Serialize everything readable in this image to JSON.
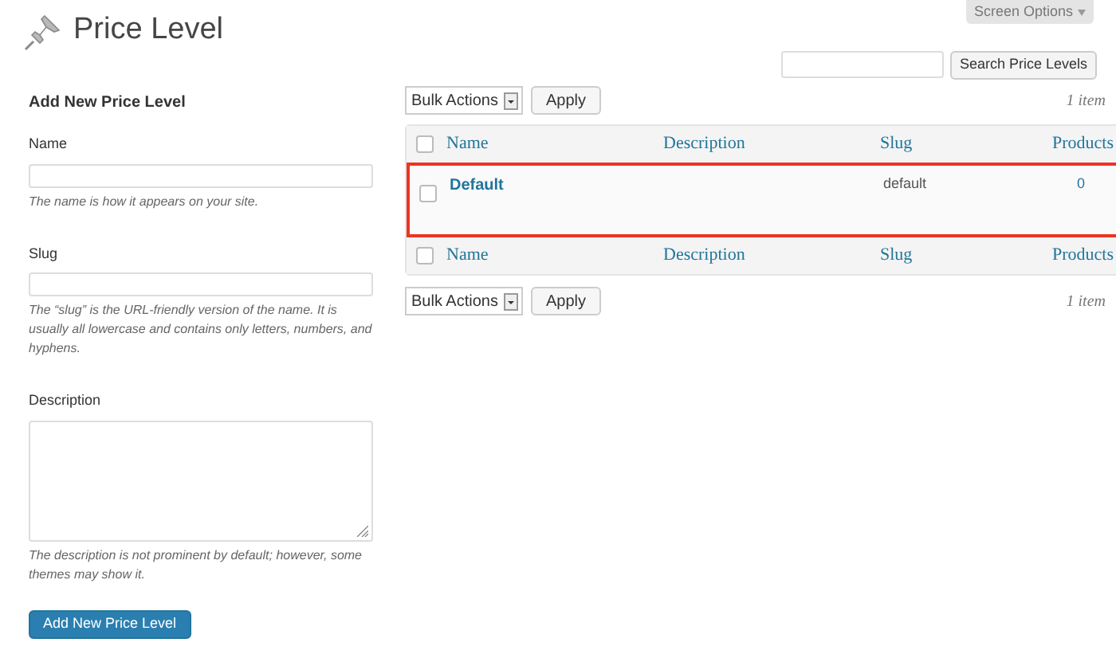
{
  "page_title": "Price Level",
  "screen_options": "Screen Options",
  "search": {
    "button": "Search Price Levels"
  },
  "form": {
    "heading": "Add New Price Level",
    "fields": [
      {
        "kind": "input",
        "label": "Name",
        "help": "The name is how it appears on your site."
      },
      {
        "kind": "input",
        "label": "Slug",
        "help": "The “slug” is the URL-friendly version of the name. It is usually all lowercase and contains only letters, numbers, and hyphens."
      },
      {
        "kind": "textarea",
        "label": "Description",
        "help": "The description is not prominent by default; however, some themes may show it."
      }
    ],
    "submit": "Add New Price Level"
  },
  "top_actions": {
    "bulk": "Bulk Actions",
    "apply": "Apply",
    "count": "1 item"
  },
  "table": {
    "select_all_checked": false,
    "footer_select_all_checked": false,
    "columns": [
      "Name",
      "Description",
      "Slug",
      "Products"
    ],
    "rows": [
      {
        "name": "Default",
        "slug": "default",
        "products": "0",
        "checked": false,
        "highlighted": true
      }
    ],
    "footer_columns": [
      "Name",
      "Description",
      "Slug",
      "Products"
    ]
  },
  "bottom_actions": {
    "bulk": "Bulk Actions",
    "apply": "Apply",
    "count": "1 item"
  }
}
